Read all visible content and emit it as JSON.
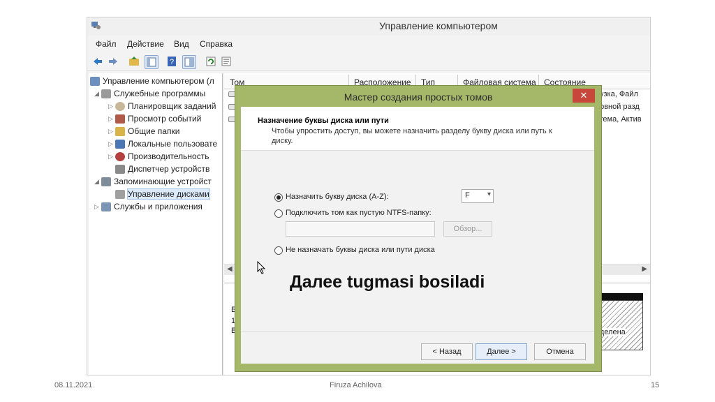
{
  "window": {
    "title": "Управление компьютером",
    "menu": [
      "Файл",
      "Действие",
      "Вид",
      "Справка"
    ]
  },
  "toolbar_icons": [
    "back-arrow-icon",
    "forward-arrow-icon",
    "up-folder-icon",
    "console-tree-icon",
    "help-icon",
    "view-icon",
    "refresh-icon",
    "properties-icon"
  ],
  "tree": {
    "items": [
      {
        "label": "Управление компьютером (л",
        "level": 0,
        "expander": ""
      },
      {
        "label": "Служебные программы",
        "level": 1,
        "expander": "◢"
      },
      {
        "label": "Планировщик заданий",
        "level": 2,
        "expander": "▷"
      },
      {
        "label": "Просмотр событий",
        "level": 2,
        "expander": "▷"
      },
      {
        "label": "Общие папки",
        "level": 2,
        "expander": "▷"
      },
      {
        "label": "Локальные пользовате",
        "level": 2,
        "expander": "▷"
      },
      {
        "label": "Производительность",
        "level": 2,
        "expander": "▷"
      },
      {
        "label": "Диспетчер устройств",
        "level": 2,
        "expander": ""
      },
      {
        "label": "Запоминающие устройст",
        "level": 1,
        "expander": "◢"
      },
      {
        "label": "Управление дисками",
        "level": 2,
        "expander": "",
        "selected": true
      },
      {
        "label": "Службы и приложения",
        "level": 1,
        "expander": "▷"
      }
    ]
  },
  "volume_list": {
    "columns": [
      "Том",
      "Расположение",
      "Тип",
      "Файловая система",
      "Состояние"
    ],
    "status_fragments": [
      "рузка, Файл",
      "новной разд",
      "стема, Актив"
    ]
  },
  "bottom_pane": {
    "left_fragments": [
      "Б",
      "1:",
      "В"
    ],
    "right_fragment": "еделена"
  },
  "dialog": {
    "title": "Мастер создания простых томов",
    "close_label": "✕",
    "step_title": "Назначение буквы диска или пути",
    "step_description": "Чтобы упростить доступ, вы можете назначить разделу букву диска или путь к диску.",
    "options": {
      "assign_letter": "Назначить букву диска (A-Z):",
      "mount_folder": "Подключить том как пустую NTFS-папку:",
      "no_letter": "Не назначать буквы диска или пути диска"
    },
    "selected_option": "assign_letter",
    "drive_letter": "F",
    "browse_label": "Обзор...",
    "buttons": {
      "back": "< Назад",
      "next": "Далее >",
      "cancel": "Отмена"
    }
  },
  "caption": "Далее tugmasi bosiladi",
  "slide_footer": {
    "date": "08.11.2021",
    "author": "Firuza Achilova",
    "page": "15"
  }
}
